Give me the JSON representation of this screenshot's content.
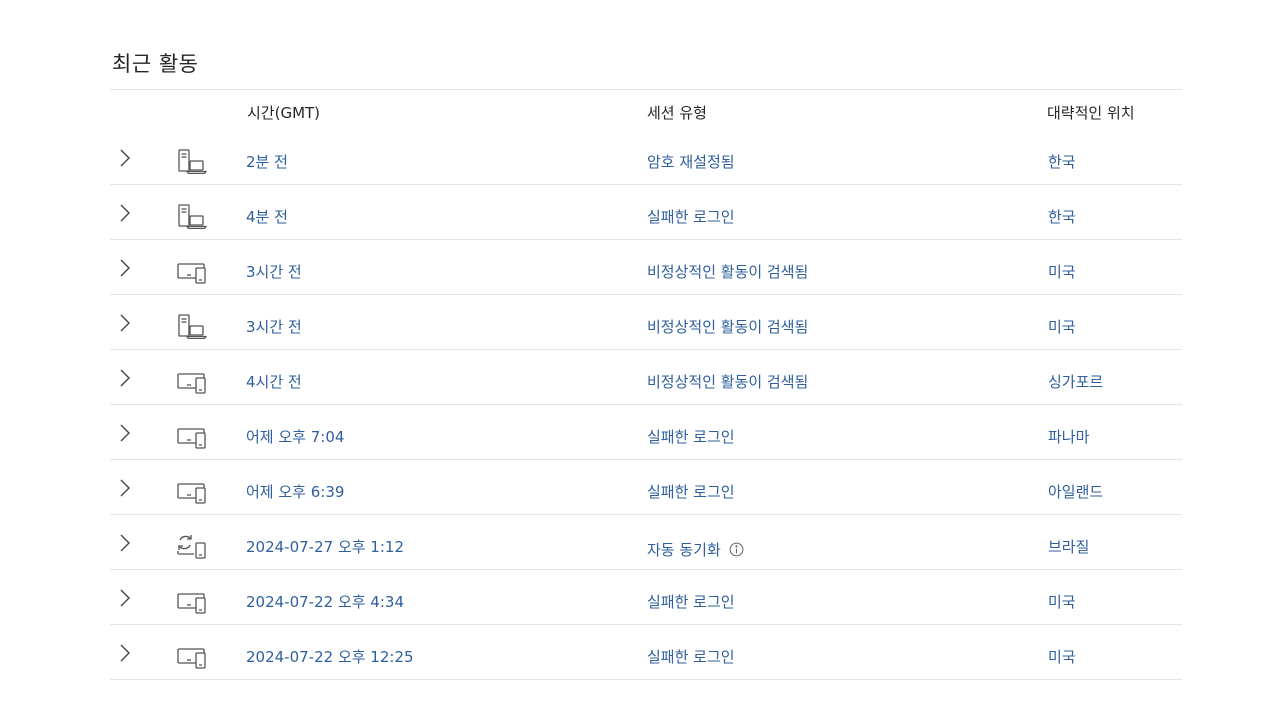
{
  "section": {
    "title": "최근 활동"
  },
  "columns": {
    "time": "시간(GMT)",
    "session_type": "세션 유형",
    "location": "대략적인 위치"
  },
  "colors": {
    "link": "#2f5f9e",
    "divider": "#e5e5e5",
    "icon": "#555555"
  },
  "rows": [
    {
      "icon": "desktop-laptop-icon",
      "time": "2분 전",
      "type": "암호 재설정됨",
      "location": "한국"
    },
    {
      "icon": "desktop-laptop-icon",
      "time": "4분 전",
      "type": "실패한 로그인",
      "location": "한국"
    },
    {
      "icon": "devices-icon",
      "time": "3시간 전",
      "type": "비정상적인 활동이 검색됨",
      "location": "미국"
    },
    {
      "icon": "desktop-laptop-icon",
      "time": "3시간 전",
      "type": "비정상적인 활동이 검색됨",
      "location": "미국"
    },
    {
      "icon": "devices-icon",
      "time": "4시간 전",
      "type": "비정상적인 활동이 검색됨",
      "location": "싱가포르"
    },
    {
      "icon": "devices-icon",
      "time": "어제 오후 7:04",
      "type": "실패한 로그인",
      "location": "파나마"
    },
    {
      "icon": "devices-icon",
      "time": "어제 오후 6:39",
      "type": "실패한 로그인",
      "location": "아일랜드"
    },
    {
      "icon": "sync-devices-icon",
      "time": "2024-07-27 오후 1:12",
      "type": "자동 동기화",
      "location": "브라질",
      "info": "info-icon"
    },
    {
      "icon": "devices-icon",
      "time": "2024-07-22 오후 4:34",
      "type": "실패한 로그인",
      "location": "미국"
    },
    {
      "icon": "devices-icon",
      "time": "2024-07-22 오후 12:25",
      "type": "실패한 로그인",
      "location": "미국"
    }
  ]
}
